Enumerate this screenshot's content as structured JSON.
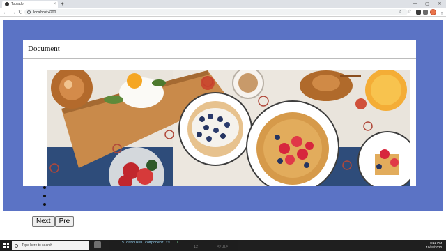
{
  "browser": {
    "tab_title": "Toolado",
    "new_tab": "+",
    "url": "localhost:4200",
    "nav": {
      "back": "←",
      "forward": "→",
      "reload": "↻"
    }
  },
  "page": {
    "card_title": "Document",
    "carousel": {
      "indicator_count": 3,
      "image": "breakfast-food-photo"
    },
    "buttons": {
      "next": "Next",
      "prev": "Pre"
    }
  },
  "taskbar": {
    "search_placeholder": "Type here to search",
    "editor_file": "TS carousel.component.ts",
    "editor_line": "12",
    "editor_code": "</ul>",
    "editor_badge": "U",
    "clock_time": "8:12 PM",
    "clock_date": "10/18/2020"
  },
  "colors": {
    "panel": "#5b73c5",
    "chrome": "#dee1e6",
    "taskbar": "#1f1f1f"
  }
}
